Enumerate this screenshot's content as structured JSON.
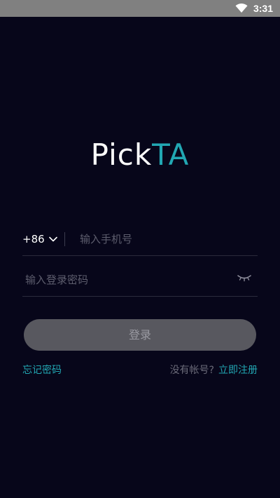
{
  "status_bar": {
    "time": "3:31",
    "wifi_icon": "wifi-icon"
  },
  "logo": {
    "part_white": "Pick",
    "part_accent": "TA",
    "accent_color": "#22a7b3"
  },
  "phone": {
    "country_code": "+86",
    "dropdown_icon": "chevron-down-icon",
    "placeholder": "输入手机号",
    "value": ""
  },
  "password": {
    "placeholder": "输入登录密码",
    "value": "",
    "visibility_icon": "eye-closed-icon"
  },
  "login_button": {
    "label": "登录"
  },
  "links": {
    "forgot_password": "忘记密码",
    "no_account": "没有帐号?",
    "register": "立即注册"
  },
  "colors": {
    "background": "#07061a",
    "accent": "#22a7b3",
    "button_disabled": "#58585f"
  }
}
